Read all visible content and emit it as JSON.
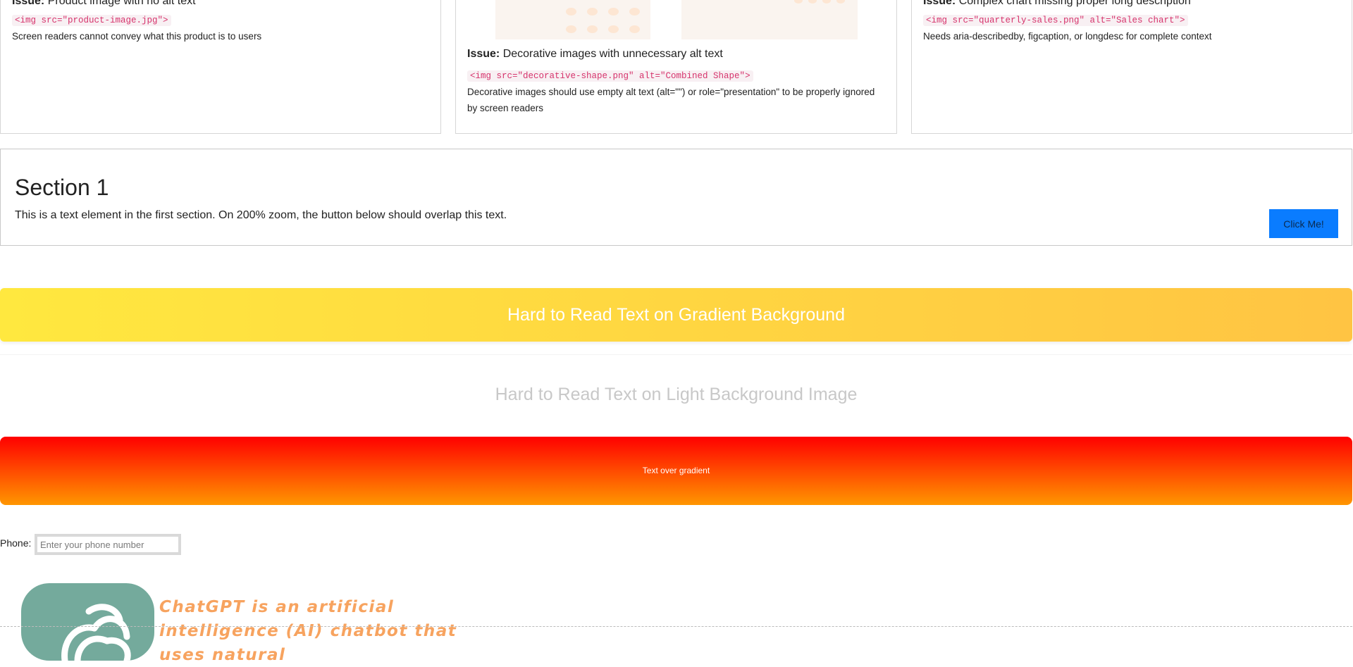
{
  "cards": [
    {
      "issue_label": "Issue:",
      "issue_text": "Product image with no alt text",
      "code": "<img src=\"product-image.jpg\">",
      "note": "Screen readers cannot convey what this product is to users"
    },
    {
      "issue_label": "Issue:",
      "issue_text": "Decorative images with unnecessary alt text",
      "code": "<img src=\"decorative-shape.png\" alt=\"Combined Shape\">",
      "note": "Decorative images should use empty alt text (alt=\"\") or role=\"presentation\" to be properly ignored by screen readers"
    },
    {
      "issue_label": "Issue:",
      "issue_text": "Complex chart missing proper long description",
      "code": "<img src=\"quarterly-sales.png\" alt=\"Sales chart\">",
      "note": "Needs aria-describedby, figcaption, or longdesc for complete context"
    }
  ],
  "section1": {
    "title": "Section 1",
    "text": "This is a text element in the first section. On 200% zoom, the button below should overlap this text.",
    "button_label": "Click Me!"
  },
  "banners": {
    "gradient_text": "Hard to Read Text on Gradient Background",
    "light_text": "Hard to Read Text on Light Background Image",
    "red_text": "Text over gradient"
  },
  "phone": {
    "label": "Phone:",
    "placeholder": "Enter your phone number"
  },
  "chatgpt": {
    "icon": "chatgpt-logo-icon",
    "text": "ChatGPT is an artificial intelligence (AI) chatbot that uses natural"
  },
  "colors": {
    "button_blue": "#0a7cff",
    "gradient_yellow_start": "#ffe83f",
    "gradient_yellow_end": "#ffc443",
    "gradient_red_top": "#ff0000",
    "gradient_orange_bottom": "#ff9600",
    "code_pink": "#d6336c",
    "chatgpt_green": "#74aa9c",
    "chatgpt_text_orange": "#f7a35f"
  }
}
